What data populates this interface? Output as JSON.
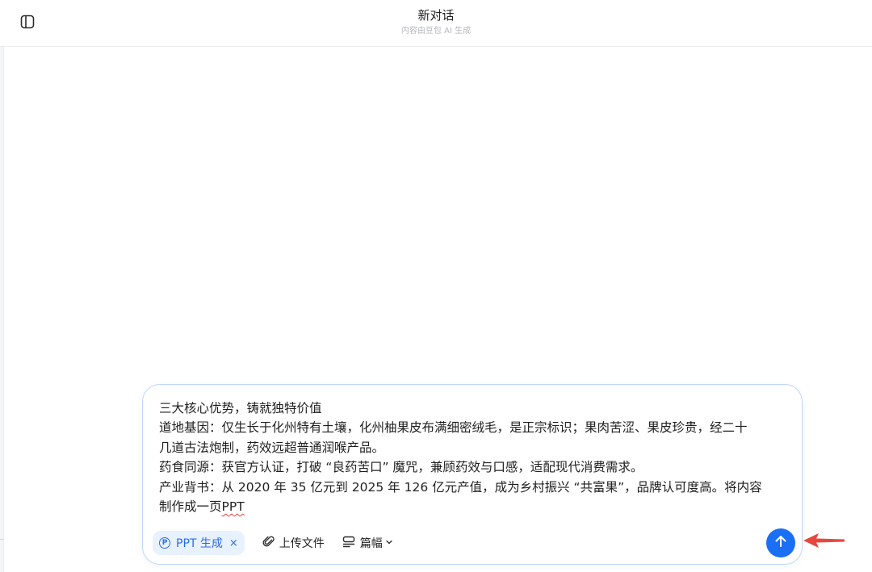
{
  "header": {
    "title": "新对话",
    "subtitle": "内容由豆包 AI 生成",
    "sidebar_toggle_icon": "sidebar-toggle-icon"
  },
  "composer": {
    "lines": [
      "三大核心优势，铸就独特价值",
      "道地基因：仅生长于化州特有土壤，化州柚果皮布满细密绒毛，是正宗标识；果肉苦涩、果皮珍贵，经二十",
      "几道古法炮制，药效远超普通润喉产品。",
      "药食同源：获官方认证，打破 “良药苦口” 魔咒，兼顾药效与口感，适配现代消费需求。",
      "产业背书：从 2020 年 35 亿元到 2025 年 126 亿元产值，成为乡村振兴 “共富果”，品牌认可度高。将内容",
      "制作成一页"
    ],
    "misspelled_word": "PPT"
  },
  "toolbar": {
    "ppt_chip_icon_letter": "P",
    "ppt_chip_label": "PPT 生成",
    "ppt_chip_close": "×",
    "upload_label": "上传文件",
    "length_label": "篇幅",
    "length_chevron": "⌄"
  },
  "colors": {
    "accent": "#1a6ff5",
    "chip_bg": "#e8f1fe",
    "chip_text": "#2a6ce8",
    "annotation_arrow": "#e8473f"
  }
}
